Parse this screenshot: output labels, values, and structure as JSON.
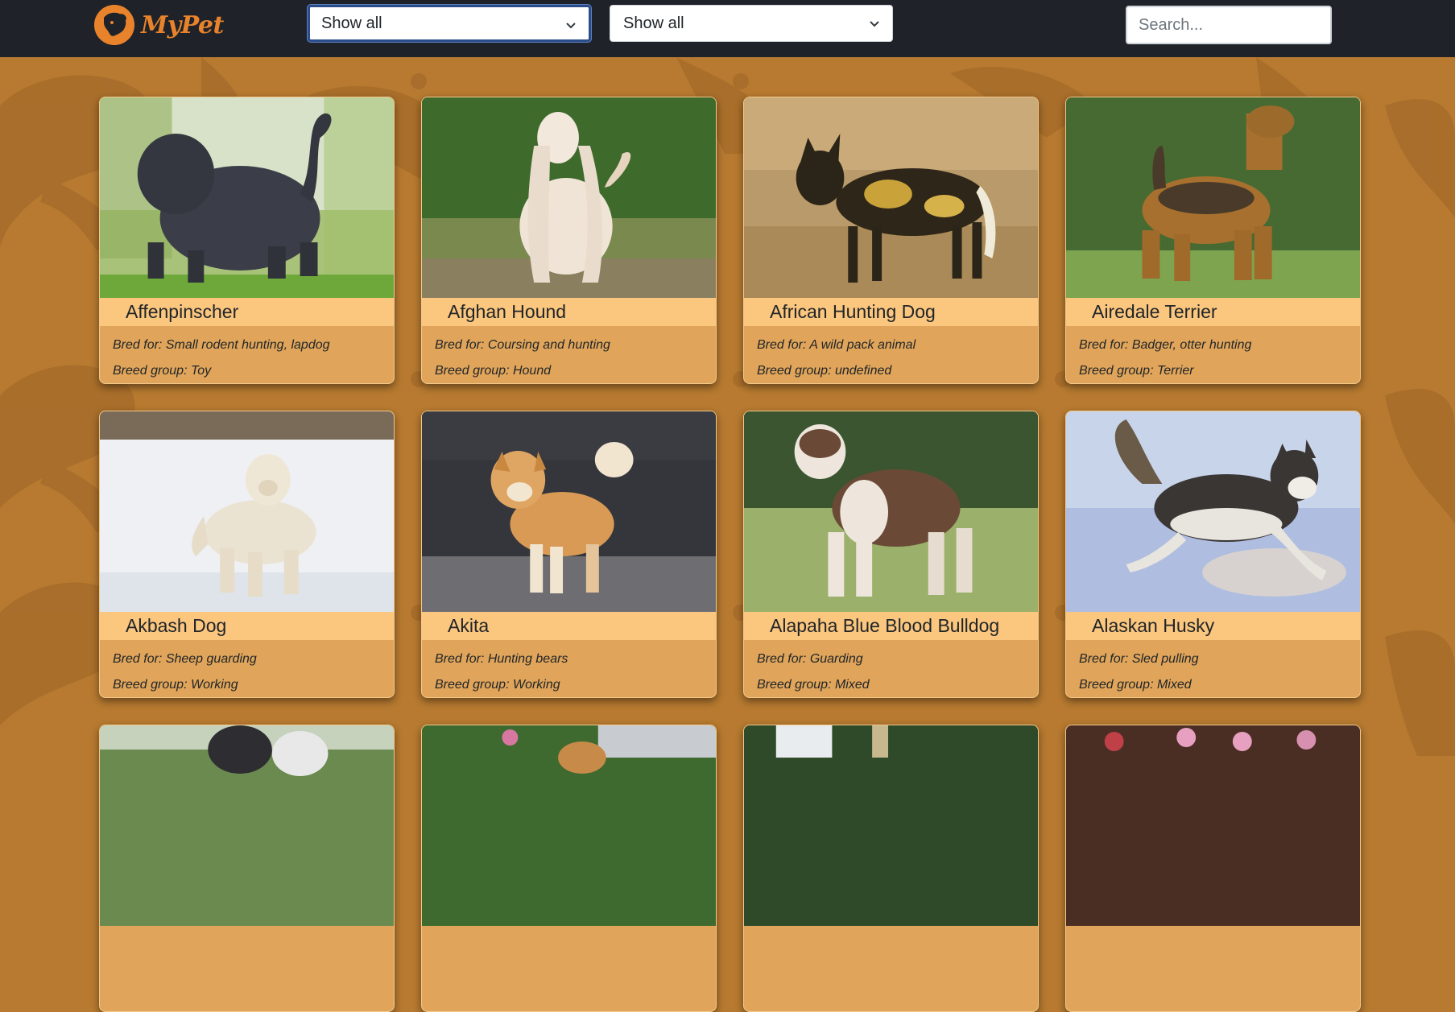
{
  "header": {
    "logo_text": "MyPet",
    "filter_1": {
      "selected": "Show all"
    },
    "filter_2": {
      "selected": "Show all"
    },
    "search": {
      "placeholder": "Search..."
    }
  },
  "colors": {
    "navbar": "#1f2329",
    "accent": "#e8832c",
    "page_background": "#b77a30",
    "card_body": "#e0a55a",
    "card_title_bar": "#fbc67e"
  },
  "labels": {
    "bred_for": "Bred for:",
    "breed_group": "Breed group:"
  },
  "breeds": [
    {
      "name": "Affenpinscher",
      "bred_for": "Small rodent hunting, lapdog",
      "breed_group": "Toy",
      "photo": "black shaggy dog on grass"
    },
    {
      "name": "Afghan Hound",
      "bred_for": "Coursing and hunting",
      "breed_group": "Hound",
      "photo": "long-haired cream hound in park"
    },
    {
      "name": "African Hunting Dog",
      "bred_for": "A wild pack animal",
      "breed_group": "undefined",
      "photo": "painted wild dog in dry grass"
    },
    {
      "name": "Airedale Terrier",
      "bred_for": "Badger, otter hunting",
      "breed_group": "Terrier",
      "photo": "tan terrier in front of ivy"
    },
    {
      "name": "Akbash Dog",
      "bred_for": "Sheep guarding",
      "breed_group": "Working",
      "photo": "white dog in snow"
    },
    {
      "name": "Akita",
      "bred_for": "Hunting bears",
      "breed_group": "Working",
      "photo": "red akita on pavement"
    },
    {
      "name": "Alapaha Blue Blood Bulldog",
      "bred_for": "Guarding",
      "breed_group": "Mixed",
      "photo": "brown and white bulldog on grass"
    },
    {
      "name": "Alaskan Husky",
      "bred_for": "Sled pulling",
      "breed_group": "Mixed",
      "photo": "husky running in snow"
    },
    {
      "name": "",
      "bred_for": "",
      "breed_group": "",
      "photo": "husky (partially visible)"
    },
    {
      "name": "",
      "bred_for": "",
      "breed_group": "",
      "photo": "dog in garden (partially visible)"
    },
    {
      "name": "",
      "bred_for": "",
      "breed_group": "",
      "photo": "dog under trees (partially visible)"
    },
    {
      "name": "",
      "bred_for": "",
      "breed_group": "",
      "photo": "dog near flowers (partially visible)"
    }
  ]
}
